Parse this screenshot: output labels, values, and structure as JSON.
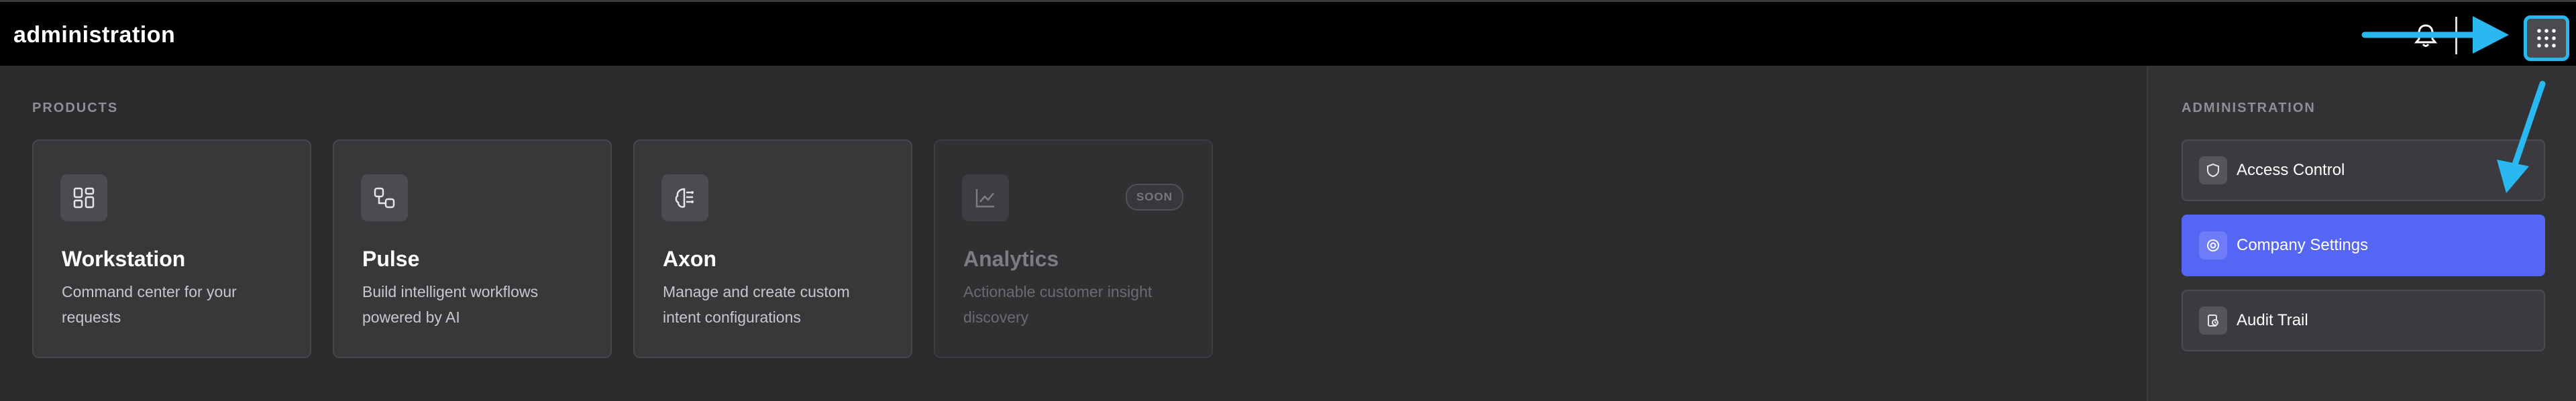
{
  "header": {
    "title": "administration",
    "icons": {
      "notifications": "bell-icon",
      "apps": "grid-icon"
    }
  },
  "products": {
    "section_label": "PRODUCTS",
    "cards": [
      {
        "title": "Workstation",
        "description": "Command center for your requests",
        "icon": "dashboard-icon",
        "enabled": true
      },
      {
        "title": "Pulse",
        "description": "Build intelligent workflows powered by AI",
        "icon": "workflow-icon",
        "enabled": true
      },
      {
        "title": "Axon",
        "description": "Manage and create custom intent configurations",
        "icon": "brain-icon",
        "enabled": true
      },
      {
        "title": "Analytics",
        "description": "Actionable customer insight discovery",
        "icon": "chart-icon",
        "enabled": false,
        "badge": "SOON"
      }
    ]
  },
  "administration": {
    "section_label": "ADMINISTRATION",
    "items": [
      {
        "label": "Access Control",
        "icon": "shield-icon",
        "active": false
      },
      {
        "label": "Company Settings",
        "icon": "settings-icon",
        "active": true
      },
      {
        "label": "Audit Trail",
        "icon": "audit-icon",
        "active": false
      }
    ]
  },
  "colors": {
    "accent": "#5566f5",
    "annotation_arrow": "#29b8f0",
    "header_bg": "#000000",
    "page_bg": "#2b2b2e"
  }
}
